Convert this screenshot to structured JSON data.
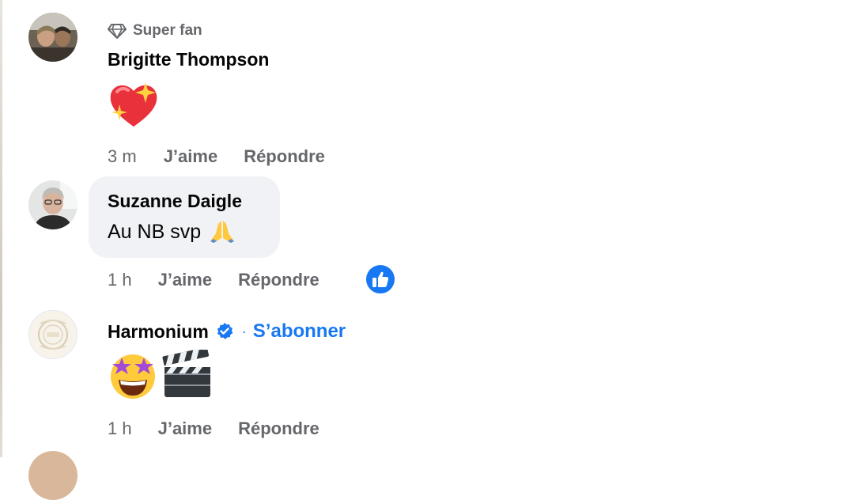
{
  "comments": [
    {
      "badge_label": "Super fan",
      "badge_icon": "diamond-icon",
      "author": "Brigitte Thompson",
      "emoji": [
        "sparkling-heart"
      ],
      "time": "3 m",
      "like_label": "J’aime",
      "reply_label": "Répondre"
    },
    {
      "author": "Suzanne Daigle",
      "text": "Au NB svp",
      "text_emoji": "folded-hands",
      "time": "1 h",
      "like_label": "J’aime",
      "reply_label": "Répondre",
      "reaction": "like"
    },
    {
      "author": "Harmonium",
      "verified": true,
      "separator": "·",
      "follow_label": "S’abonner",
      "emoji": [
        "star-struck-face",
        "clapper-board"
      ],
      "time": "1 h",
      "like_label": "J’aime",
      "reply_label": "Répondre"
    }
  ],
  "colors": {
    "link_blue": "#1877f2",
    "secondary_text": "#65676b",
    "bubble_bg": "#f0f2f5"
  }
}
